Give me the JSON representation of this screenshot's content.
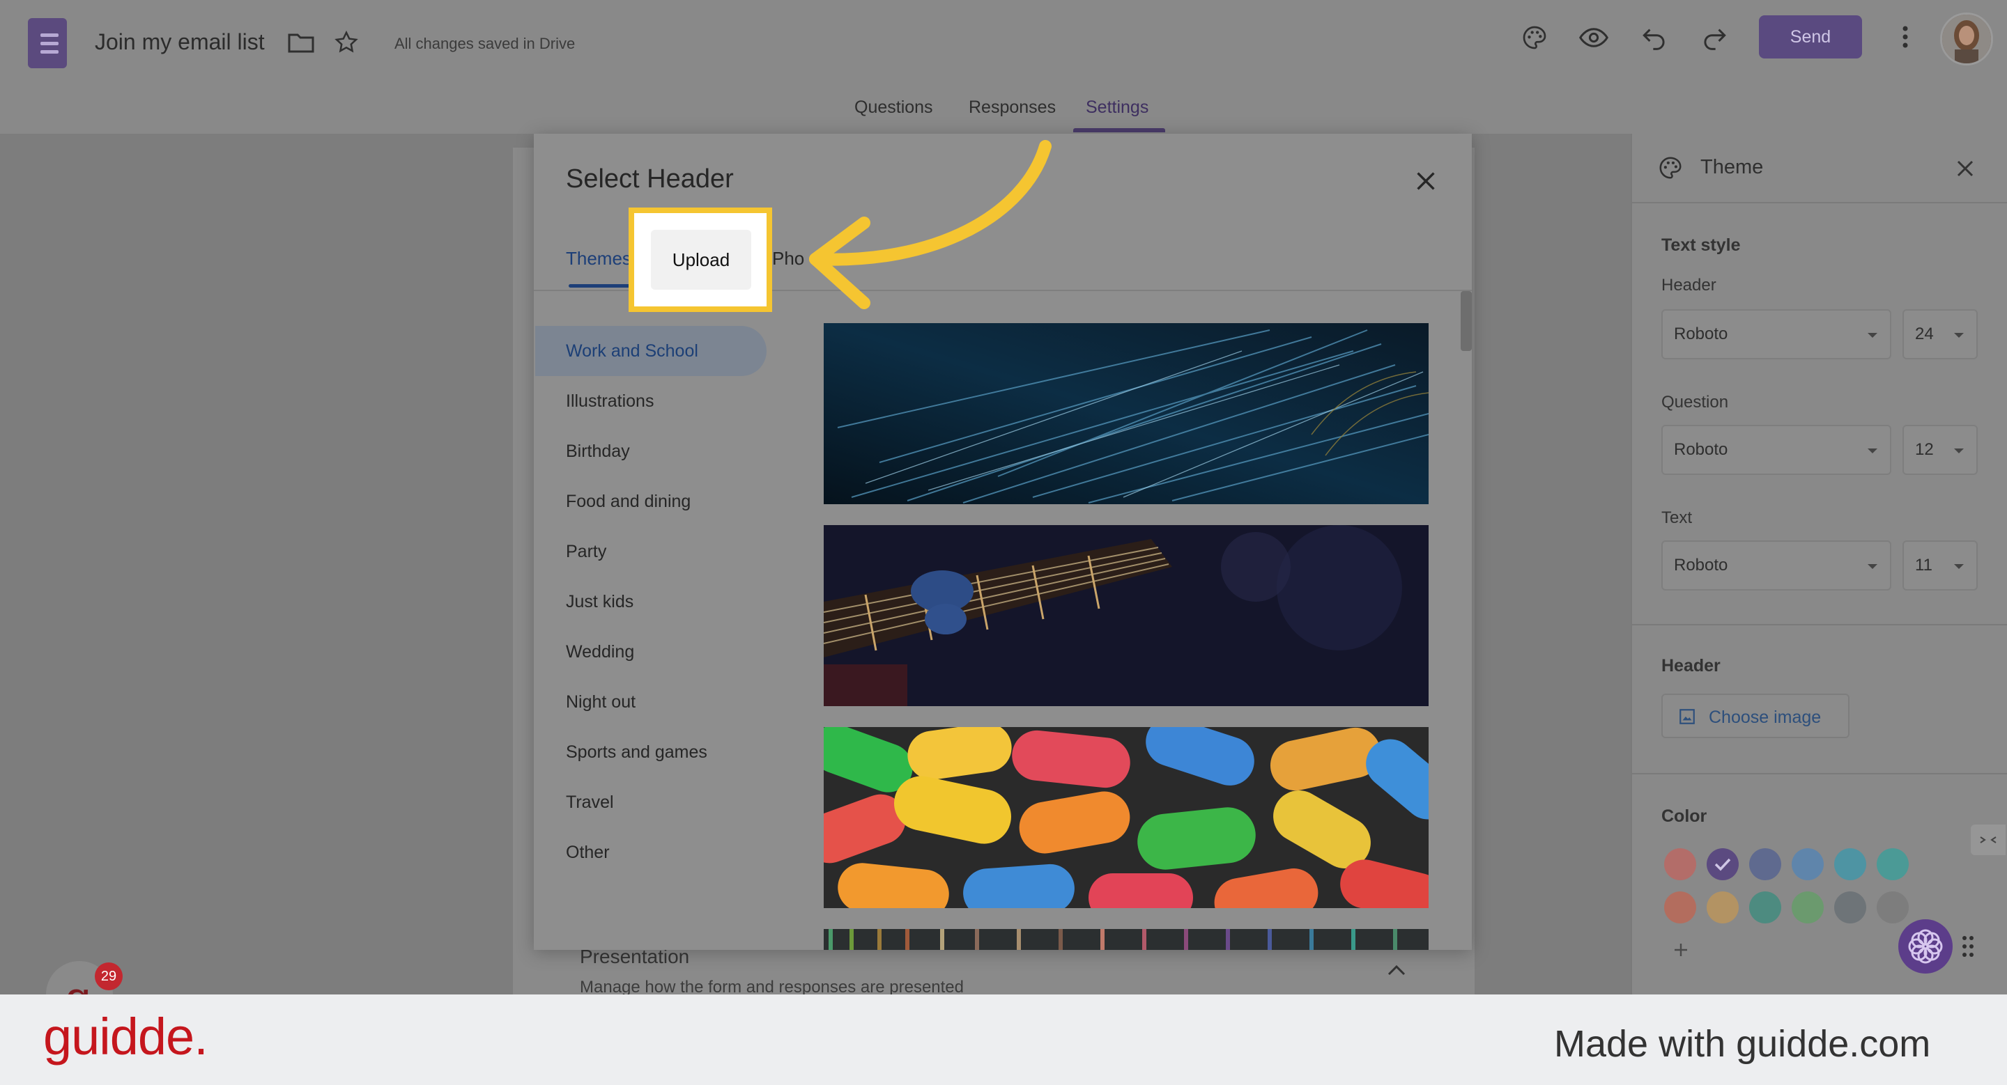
{
  "app": {
    "title": "Join my email list",
    "save_status": "All changes saved in Drive",
    "send_label": "Send"
  },
  "tabs": [
    {
      "label": "Questions"
    },
    {
      "label": "Responses"
    },
    {
      "label": "Settings",
      "active": true
    }
  ],
  "modal": {
    "title": "Select Header",
    "tabs": [
      {
        "label": "Themes",
        "active": true
      },
      {
        "label": "Upload"
      },
      {
        "label": "Pho"
      }
    ],
    "categories": [
      {
        "label": "Work and School",
        "active": true
      },
      {
        "label": "Illustrations"
      },
      {
        "label": "Birthday"
      },
      {
        "label": "Food and dining"
      },
      {
        "label": "Party"
      },
      {
        "label": "Just kids"
      },
      {
        "label": "Wedding"
      },
      {
        "label": "Night out"
      },
      {
        "label": "Sports and games"
      },
      {
        "label": "Travel"
      },
      {
        "label": "Other"
      }
    ]
  },
  "highlight": {
    "label": "Upload"
  },
  "background_form": {
    "section_title": "Presentation",
    "section_subtitle": "Manage how the form and responses are presented"
  },
  "theme_panel": {
    "title": "Theme",
    "text_style_label": "Text style",
    "header_label": "Header",
    "header_font": "Roboto",
    "header_size": "24",
    "question_label": "Question",
    "question_font": "Roboto",
    "question_size": "12",
    "text_label": "Text",
    "text_font": "Roboto",
    "text_size": "11",
    "header_section_label": "Header",
    "choose_image_label": "Choose image",
    "color_label": "Color",
    "colors_row1": [
      "#b36d69",
      "#5b4a80",
      "#5f6a8f",
      "#5f85ab",
      "#4e94a3",
      "#4b9a96"
    ],
    "colors_row2": [
      "#b36d5e",
      "#b39363",
      "#4d8b80",
      "#6b9a6e",
      "#6e7478",
      "#7d7d7d"
    ]
  },
  "badge": {
    "count": "29"
  },
  "footer": {
    "brand": "guidde.",
    "made_with": "Made with guidde.com"
  }
}
